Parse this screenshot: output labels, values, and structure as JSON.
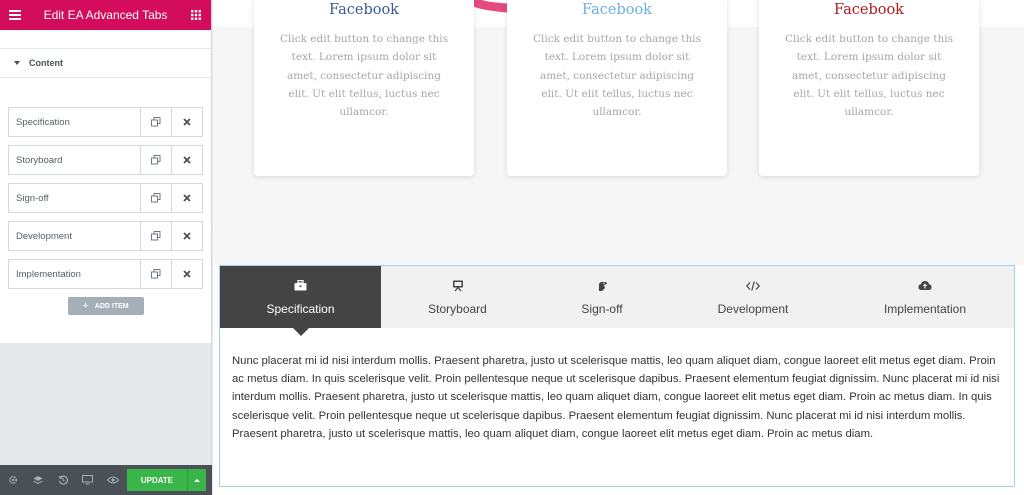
{
  "panel": {
    "title": "Edit EA Advanced Tabs",
    "section_label": "Content",
    "items": [
      {
        "label": "Specification"
      },
      {
        "label": "Storyboard"
      },
      {
        "label": "Sign-off"
      },
      {
        "label": "Development"
      },
      {
        "label": "Implementation"
      }
    ],
    "add_item_label": "ADD ITEM",
    "footer": {
      "icons": [
        "gear-icon",
        "layers-icon",
        "history-icon",
        "responsive-icon",
        "preview-eye-icon"
      ],
      "update_label": "UPDATE"
    }
  },
  "preview": {
    "cards": [
      {
        "title": "Facebook",
        "title_color": "#3b5998",
        "body": "Click edit button to change this text. Lorem ipsum dolor sit amet, consectetur adipiscing elit. Ut elit tellus, luctus nec ullamcor."
      },
      {
        "title": "Facebook",
        "title_color": "#69b0e4",
        "body": "Click edit button to change this text. Lorem ipsum dolor sit amet, consectetur adipiscing elit. Ut elit tellus, luctus nec ullamcor."
      },
      {
        "title": "Facebook",
        "title_color": "#b01c1c",
        "body": "Click edit button to change this text. Lorem ipsum dolor sit amet, consectetur adipiscing elit. Ut elit tellus, luctus nec ullamcor."
      }
    ],
    "tabs": [
      {
        "label": "Specification",
        "icon": "briefcase-icon",
        "active": true
      },
      {
        "label": "Storyboard",
        "icon": "storyboard-icon",
        "active": false
      },
      {
        "label": "Sign-off",
        "icon": "signoff-icon",
        "active": false
      },
      {
        "label": "Development",
        "icon": "code-icon",
        "active": false
      },
      {
        "label": "Implementation",
        "icon": "cloud-upload-icon",
        "active": false
      }
    ],
    "tab_content": "Nunc placerat mi id nisi interdum mollis. Praesent pharetra, justo ut scelerisque mattis, leo quam aliquet diam, congue laoreet elit metus eget diam. Proin ac metus diam. In quis scelerisque velit. Proin pellentesque neque ut scelerisque dapibus. Praesent elementum feugiat dignissim. Nunc placerat mi id nisi interdum mollis. Praesent pharetra, justo ut scelerisque mattis, leo quam aliquet diam, congue laoreet elit metus eget diam. Proin ac metus diam. In quis scelerisque velit. Proin pellentesque neque ut scelerisque dapibus. Praesent elementum feugiat dignissim. Nunc placerat mi id nisi interdum mollis. Praesent pharetra, justo ut scelerisque mattis, leo quam aliquet diam, congue laoreet elit metus eget diam. Proin ac metus diam."
  },
  "colors": {
    "header": "#d30c5c",
    "update": "#39b54a",
    "active_tab": "#444444",
    "footer": "#495157"
  }
}
